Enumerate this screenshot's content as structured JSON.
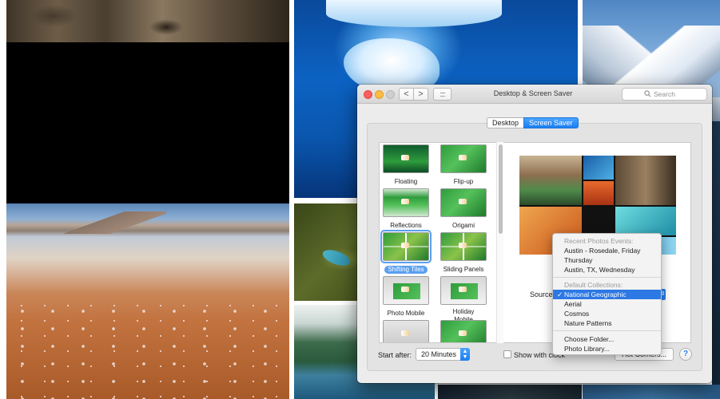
{
  "window": {
    "title": "Desktop & Screen Saver",
    "search_placeholder": "Search",
    "nav_back": "<",
    "nav_forward": ">",
    "grid_label": "::::"
  },
  "tabs": [
    {
      "label": "Desktop",
      "selected": false
    },
    {
      "label": "Screen Saver",
      "selected": true
    }
  ],
  "screen_savers": [
    {
      "label": "Floating",
      "selected": false
    },
    {
      "label": "Flip-up",
      "selected": false
    },
    {
      "label": "Reflections",
      "selected": false
    },
    {
      "label": "Origami",
      "selected": false
    },
    {
      "label": "Shifting Tiles",
      "selected": true
    },
    {
      "label": "Sliding Panels",
      "selected": false
    },
    {
      "label": "Photo Mobile",
      "selected": false
    },
    {
      "label": "Holiday Mobile",
      "selected": false
    }
  ],
  "source": {
    "label": "Source:",
    "menu": {
      "recent_header": "Recent Photos Events:",
      "recent_items": [
        "Austin - Rosedale, Friday",
        "Thursday",
        "Austin, TX, Wednesday"
      ],
      "collections_header": "Default Collections:",
      "collections": [
        {
          "label": "National Geographic",
          "checked": true
        },
        {
          "label": "Aerial",
          "checked": false
        },
        {
          "label": "Cosmos",
          "checked": false
        },
        {
          "label": "Nature Patterns",
          "checked": false
        }
      ],
      "actions": [
        "Choose Folder...",
        "Photo Library..."
      ],
      "check_glyph": "✓"
    }
  },
  "bottom_bar": {
    "start_after_label": "Start after:",
    "start_after_value": "20 Minutes",
    "show_clock_label": "Show with clock",
    "show_clock_checked": false,
    "hot_corners_label": "Hot Corners...",
    "help_label": "?"
  },
  "colors": {
    "accent": "#2c78e4",
    "close": "#fc605c",
    "minimize": "#fdbc40",
    "zoom_disabled": "#cfcfcf"
  },
  "icons": [
    "search-icon",
    "chevron-left-icon",
    "chevron-right-icon",
    "grid-icon",
    "checkmark-icon",
    "help-icon",
    "stepper-icon"
  ]
}
